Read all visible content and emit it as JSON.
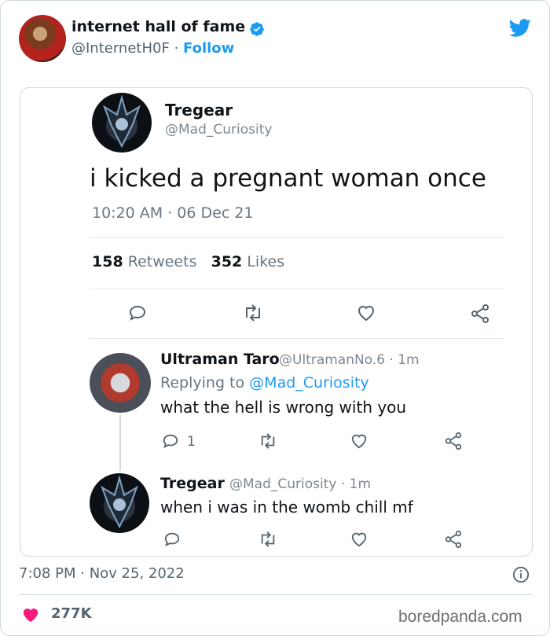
{
  "header": {
    "display_name": "internet hall of fame",
    "handle": "@InternetH0F",
    "separator": "·",
    "follow_label": "Follow"
  },
  "card": {
    "main_tweet": {
      "name": "Tregear",
      "handle": "@Mad_Curiosity",
      "text": "i kicked a pregnant woman once",
      "time": "10:20 AM · 06 Dec 21",
      "retweets_count": "158",
      "retweets_label": "Retweets",
      "likes_count": "352",
      "likes_label": "Likes"
    },
    "reply_1": {
      "name": "Ultraman Taro",
      "handle": "@UltramanNo.6 · 1m",
      "replying_prefix": "Replying to",
      "replying_handle": "@Mad_Curiosity",
      "text": "what the hell is wrong with you",
      "reply_count": "1"
    },
    "reply_2": {
      "name": "Tregear",
      "handle": "@Mad_Curiosity · 1m",
      "text": "when i was in the womb chill mf"
    }
  },
  "footer": {
    "timestamp": "7:08 PM · Nov 25, 2022",
    "likes": "277K",
    "watermark": "boredpanda.com"
  },
  "colors": {
    "twitter_blue": "#1d9bf0",
    "heart_red": "#f91880",
    "text_dark": "#0f1419",
    "text_gray": "#536471"
  },
  "icons": [
    "verified-badge-icon",
    "twitter-bird-icon",
    "reply-icon",
    "retweet-icon",
    "like-icon",
    "share-icon",
    "info-icon",
    "heart-icon"
  ]
}
